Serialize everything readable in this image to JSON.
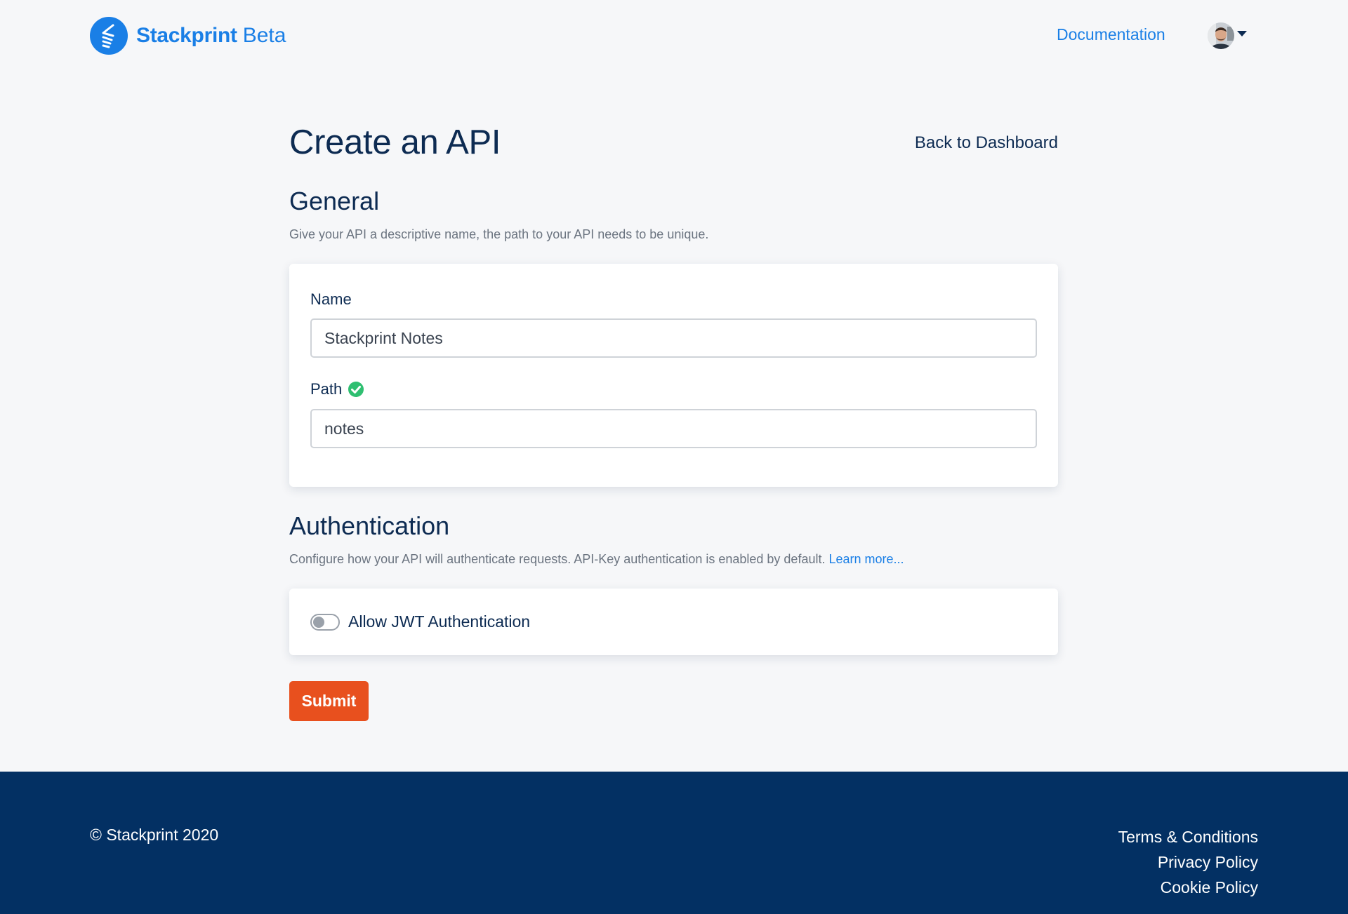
{
  "header": {
    "brand_name": "Stackprint",
    "brand_tag": "Beta",
    "documentation_link": "Documentation",
    "brand_color": "#1a7fe6"
  },
  "main": {
    "page_title": "Create an API",
    "back_link": "Back to Dashboard",
    "general": {
      "title": "General",
      "description": "Give your API a descriptive name, the path to your API needs to be unique.",
      "name_label": "Name",
      "name_value": "Stackprint Notes",
      "path_label": "Path",
      "path_value": "notes",
      "path_status_icon": "check-circle-icon",
      "path_status_color": "#2fbf71"
    },
    "authentication": {
      "title": "Authentication",
      "description": "Configure how your API will authenticate requests. API-Key authentication is enabled by default.",
      "learn_more": "Learn more...",
      "jwt_toggle_label": "Allow JWT Authentication",
      "jwt_enabled": false
    },
    "submit_label": "Submit",
    "submit_color": "#e8501e"
  },
  "footer": {
    "copyright": "© Stackprint 2020",
    "links": [
      "Terms & Conditions",
      "Privacy Policy",
      "Cookie Policy"
    ],
    "background": "#033063"
  }
}
